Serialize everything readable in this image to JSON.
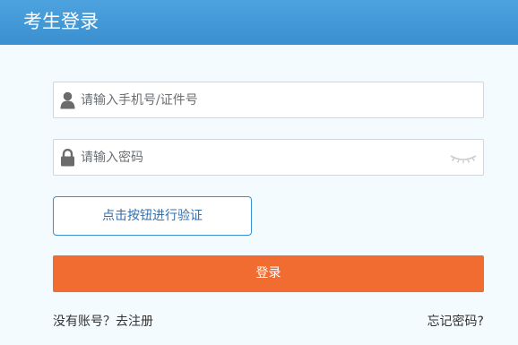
{
  "header": {
    "title": "考生登录"
  },
  "form": {
    "account_placeholder": "请输入手机号/证件号",
    "password_placeholder": "请输入密码",
    "verify_label": "点击按钮进行验证",
    "login_label": "登录"
  },
  "links": {
    "register": "没有账号？去注册",
    "forgot": "忘记密码?"
  },
  "icons": {
    "account": "user-icon",
    "password": "lock-icon",
    "toggle": "eye-closed-icon"
  },
  "colors": {
    "header": "#3a8fd0",
    "login_button": "#f16c30",
    "verify_text": "#2e6fb0"
  }
}
